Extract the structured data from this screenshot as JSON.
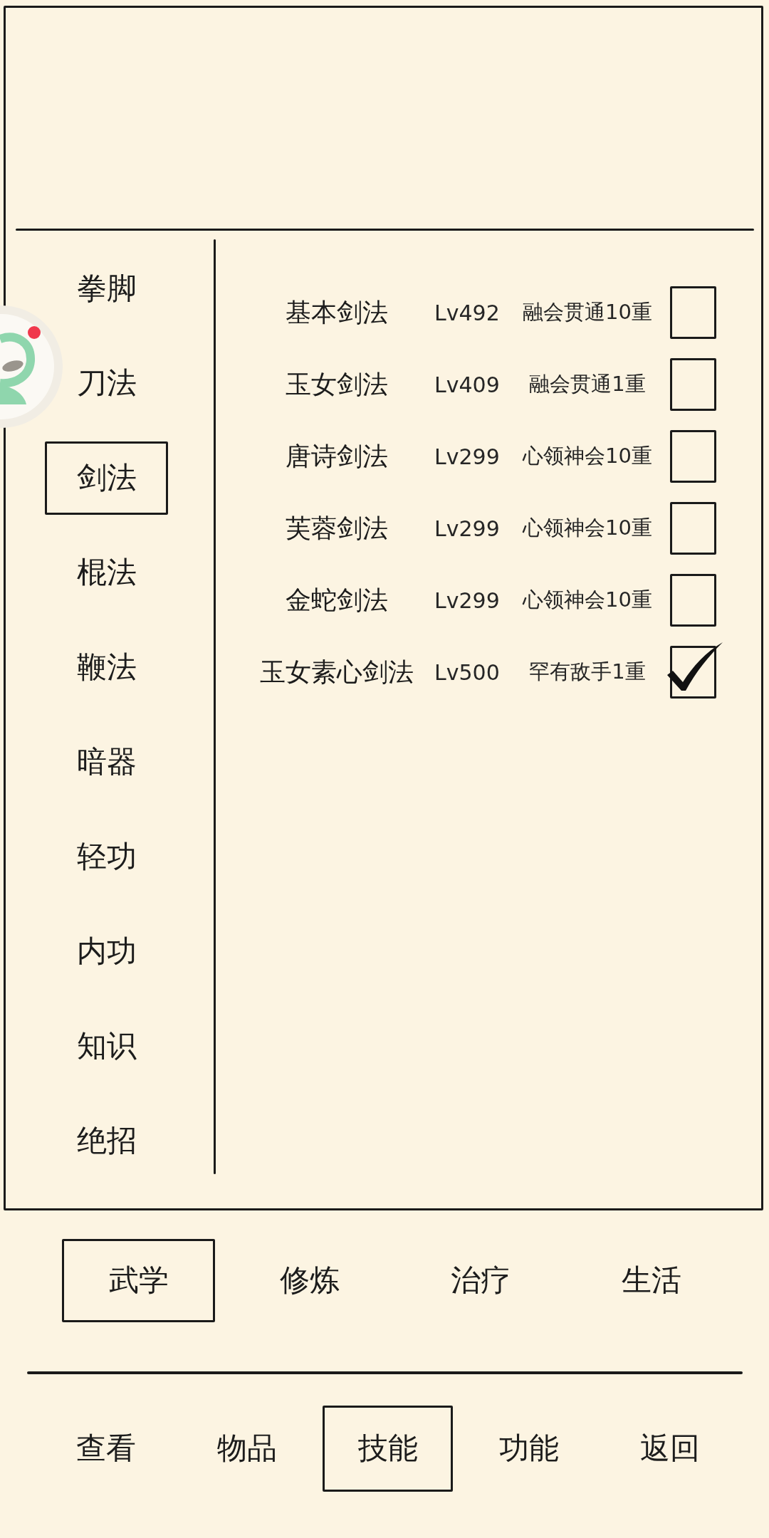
{
  "assistant": {
    "notification": true
  },
  "categories": [
    {
      "label": "拳脚",
      "selected": false
    },
    {
      "label": "刀法",
      "selected": false
    },
    {
      "label": "剑法",
      "selected": true
    },
    {
      "label": "棍法",
      "selected": false
    },
    {
      "label": "鞭法",
      "selected": false
    },
    {
      "label": "暗器",
      "selected": false
    },
    {
      "label": "轻功",
      "selected": false
    },
    {
      "label": "内功",
      "selected": false
    },
    {
      "label": "知识",
      "selected": false
    },
    {
      "label": "绝招",
      "selected": false
    }
  ],
  "skills": [
    {
      "name": "基本剑法",
      "level": "Lv492",
      "rank": "融会贯通10重",
      "checked": false
    },
    {
      "name": "玉女剑法",
      "level": "Lv409",
      "rank": "融会贯通1重",
      "checked": false
    },
    {
      "name": "唐诗剑法",
      "level": "Lv299",
      "rank": "心领神会10重",
      "checked": false
    },
    {
      "name": "芙蓉剑法",
      "level": "Lv299",
      "rank": "心领神会10重",
      "checked": false
    },
    {
      "name": "金蛇剑法",
      "level": "Lv299",
      "rank": "心领神会10重",
      "checked": false
    },
    {
      "name": "玉女素心剑法",
      "level": "Lv500",
      "rank": "罕有敌手1重",
      "checked": true
    }
  ],
  "tabs": [
    {
      "label": "武学",
      "selected": true
    },
    {
      "label": "修炼",
      "selected": false
    },
    {
      "label": "治疗",
      "selected": false
    },
    {
      "label": "生活",
      "selected": false
    }
  ],
  "nav": [
    {
      "label": "查看",
      "selected": false
    },
    {
      "label": "物品",
      "selected": false
    },
    {
      "label": "技能",
      "selected": true
    },
    {
      "label": "功能",
      "selected": false
    },
    {
      "label": "返回",
      "selected": false
    }
  ]
}
